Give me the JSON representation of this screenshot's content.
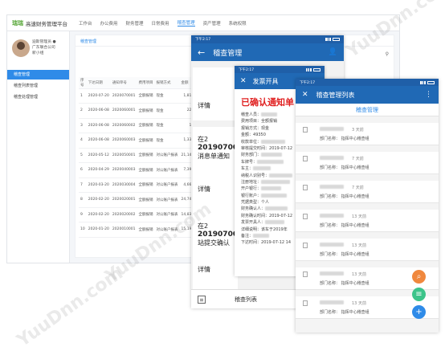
{
  "desktop": {
    "logo": "瑞瑞",
    "title": "高速财务管理平台",
    "nav": [
      "工作台",
      "办公费用",
      "财务管理",
      "日常费用",
      "稽查管理",
      "资产管理",
      "系统权限"
    ],
    "active_nav": "稽查管理",
    "top_button": "",
    "user_info": [
      "迪斯管理员 ●",
      "广东联合公司",
      "新小组"
    ],
    "menu": [
      "稽查管理",
      "稽查列表管理",
      "稽查处理管理"
    ],
    "active_menu": "稽查管理",
    "breadcrumb": "稽查管理",
    "table": {
      "headers": [
        "序号",
        "下达日期",
        "通知单号",
        "费用项目",
        "报销方式",
        "金额"
      ],
      "rows": [
        [
          "1",
          "2020-07-20",
          "2020070001",
          "全额报销",
          "现金",
          "1,814.00"
        ],
        [
          "2",
          "2020-06-08",
          "2020060001",
          "全额报销",
          "现金",
          "220.00"
        ],
        [
          "3",
          "2020-06-08",
          "2020060002",
          "全额报销",
          "现金",
          "15.00"
        ],
        [
          "4",
          "2020-06-08",
          "2020060003",
          "全额报销",
          "现金",
          "1,330.00"
        ],
        [
          "5",
          "2020-05-12",
          "2020050001",
          "全额报销",
          "对公账户报表",
          "21,145.00"
        ],
        [
          "6",
          "2020-04-29",
          "2020040003",
          "全额报销",
          "对公账户报表",
          "7,395.00"
        ],
        [
          "7",
          "2020-03-20",
          "2020030004",
          "全额报销",
          "对公账户报表",
          "4,665.00"
        ],
        [
          "8",
          "2020-02-20",
          "2020020001",
          "全额报销",
          "对公账户报表",
          "24,745.00"
        ],
        [
          "9",
          "2020-02-20",
          "2020020002",
          "全额报销",
          "对公账户报表",
          "14,833.00"
        ],
        [
          "10",
          "2020-01-20",
          "2020010001",
          "全额报销",
          "对公账户报表",
          "15,190.00"
        ]
      ]
    }
  },
  "phone1": {
    "time": "下午2:17",
    "title": "稽查管理",
    "cards": [
      {
        "line1": "",
        "line2": "",
        "detail": "详情"
      },
      {
        "line1": "在2",
        "line2": "20190700",
        "line3": "消息单通知",
        "detail": "详情"
      },
      {
        "line1": "在2",
        "line2": "20190700",
        "line3": "站提交确认",
        "detail": "详情"
      }
    ],
    "footer": "稽查列表"
  },
  "phone2": {
    "time": "下午2:17",
    "title": "发票开具",
    "notice": "已确认通知单",
    "fields": [
      [
        "稽查人员：",
        ""
      ],
      [
        "费用项目：",
        "全额报销"
      ],
      [
        "报销方式：",
        "现金"
      ],
      [
        "金额：",
        "49350"
      ],
      [
        "收款单位：",
        ""
      ],
      [
        "审核提交时间：",
        "2019-07-12"
      ],
      [
        "财务部门：",
        ""
      ],
      [
        "车牌号：",
        ""
      ],
      [
        "车主：",
        ""
      ],
      [
        "纳税人识别号：",
        ""
      ],
      [
        "注册地址：",
        ""
      ],
      [
        "开户银行：",
        ""
      ],
      [
        "银行账户：",
        ""
      ],
      [
        "凭据类型：",
        "个人"
      ],
      [
        "财务确认人：",
        ""
      ],
      [
        "财务确认时间：",
        "2019-07-12"
      ],
      [
        "发票开具人：",
        ""
      ],
      [
        "详细说明：",
        "该车于2019年"
      ],
      [
        "备注：",
        ""
      ],
      [
        "下达时间：",
        "2019-07-12 14"
      ]
    ]
  },
  "phone3": {
    "time": "下午2:17",
    "title": "稽查管理列表",
    "tab": "稽查管理",
    "items": [
      {
        "time": "3 天前",
        "dept": "部门名称：  指挥中心稽查组"
      },
      {
        "time": "7 天前",
        "dept": "部门名称：  指挥中心稽查组"
      },
      {
        "time": "7 天前",
        "dept": "部门名称：  指挥中心稽查组"
      },
      {
        "time": "13 天前",
        "dept": "部门名称：  指挥中心稽查组"
      },
      {
        "time": "13 天前",
        "dept": "部门名称：  指挥中心稽查组"
      },
      {
        "time": "13 天前",
        "dept": "部门名称：  指挥中心稽查组"
      },
      {
        "time": "13 天前",
        "dept": "部门名称：  指挥中心稽查组"
      }
    ],
    "fab_colors": [
      "#f0883e",
      "#3cc48a",
      "#2f8be8"
    ]
  },
  "watermark": "YuuDnn.com"
}
